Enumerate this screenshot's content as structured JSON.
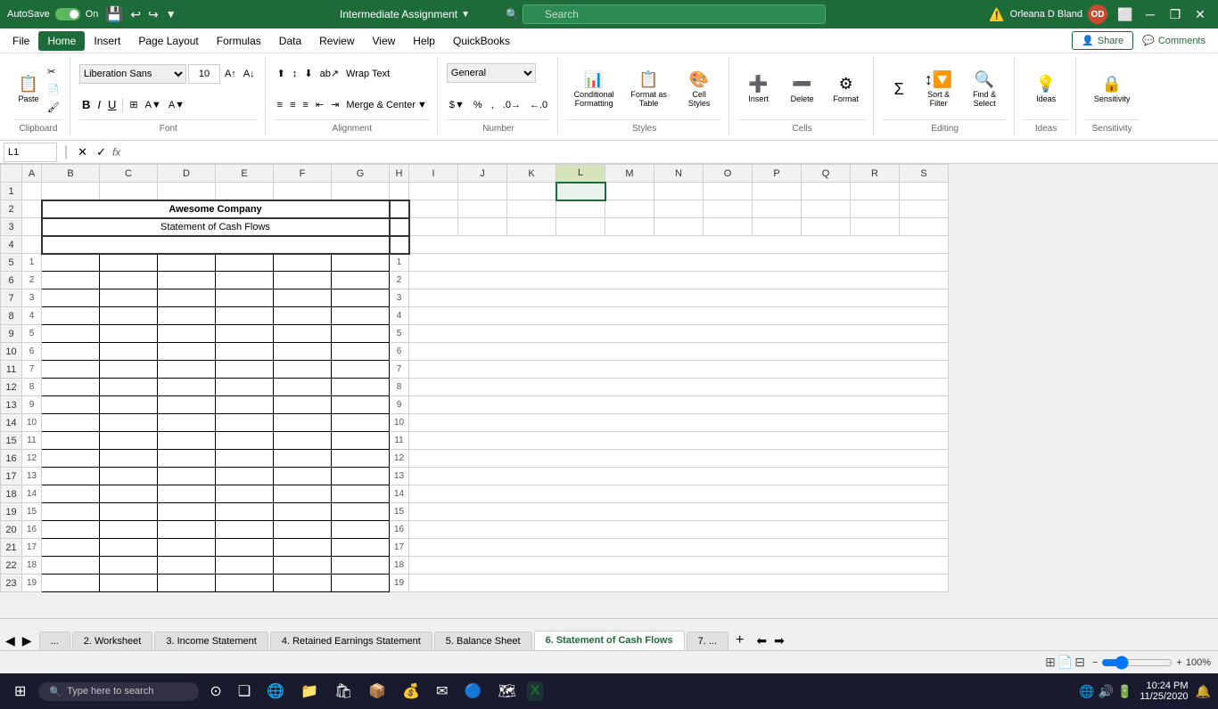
{
  "titlebar": {
    "autosave_label": "AutoSave",
    "autosave_state": "On",
    "title": "Intermediate Assignment",
    "search_placeholder": "Search",
    "user_name": "Orleana D Bland",
    "user_initials": "OD"
  },
  "menubar": {
    "items": [
      "File",
      "Home",
      "Insert",
      "Page Layout",
      "Formulas",
      "Data",
      "Review",
      "View",
      "Help",
      "QuickBooks"
    ],
    "active": "Home",
    "share_label": "Share",
    "comments_label": "Comments"
  },
  "ribbon": {
    "clipboard": {
      "label": "Clipboard",
      "paste_label": "Paste"
    },
    "font": {
      "label": "Font",
      "font_name": "Liberation Sans",
      "font_size": "10",
      "bold": "B",
      "italic": "I",
      "underline": "U"
    },
    "alignment": {
      "label": "Alignment",
      "wrap_text": "Wrap Text",
      "merge_center": "Merge & Center"
    },
    "number": {
      "label": "Number",
      "format": "General"
    },
    "styles": {
      "label": "Styles",
      "conditional_formatting": "Conditional Formatting",
      "format_as_table": "Format as Table",
      "cell_styles": "Cell Styles"
    },
    "cells": {
      "label": "Cells",
      "insert": "Insert",
      "delete": "Delete",
      "format": "Format"
    },
    "editing": {
      "label": "Editing",
      "sum": "Σ",
      "sort_filter": "Sort & Filter",
      "find_select": "Find & Select"
    },
    "ideas": {
      "label": "Ideas",
      "ideas_btn": "Ideas"
    },
    "sensitivity": {
      "label": "Sensitivity",
      "sensitivity_btn": "Sensitivity"
    }
  },
  "formula_bar": {
    "cell_ref": "L1",
    "fx": "fx",
    "formula": ""
  },
  "spreadsheet": {
    "company_name": "Awesome Company",
    "subtitle": "Statement of Cash Flows",
    "columns": [
      "",
      "A",
      "B",
      "C",
      "D",
      "E",
      "F",
      "G",
      "H",
      "I",
      "J",
      "K",
      "L",
      "M",
      "N",
      "O",
      "P",
      "Q",
      "R",
      "S"
    ],
    "selected_cell": "L1",
    "row_numbers": [
      1,
      2,
      3,
      4,
      5,
      6,
      7,
      8,
      9,
      10,
      11,
      12,
      13,
      14,
      15,
      16,
      17,
      18,
      19,
      20,
      21,
      22,
      23
    ],
    "side_numbers": [
      1,
      2,
      3,
      4,
      5,
      6,
      7,
      8,
      9,
      10,
      11,
      12,
      13,
      14,
      15,
      16,
      17,
      18,
      19
    ]
  },
  "sheet_tabs": {
    "tabs": [
      "...",
      "2. Worksheet",
      "3. Income Statement",
      "4. Retained Earnings Statement",
      "5. Balance Sheet",
      "6. Statement of Cash Flows",
      "7. ..."
    ],
    "active": "6. Statement of Cash Flows"
  },
  "status_bar": {
    "zoom": "100%"
  },
  "taskbar": {
    "search_placeholder": "Type here to search",
    "time": "10:24 PM",
    "date": "11/25/2020"
  }
}
